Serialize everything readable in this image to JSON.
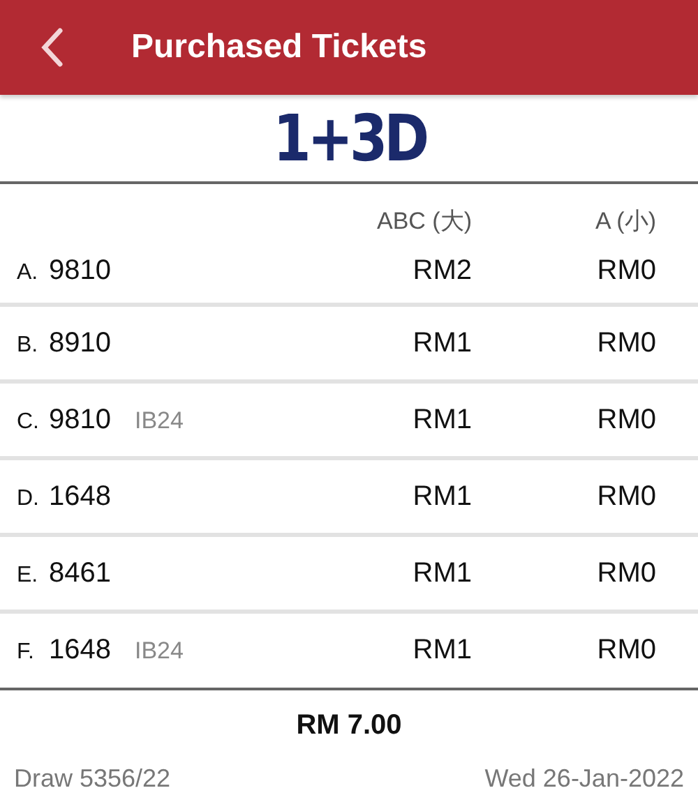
{
  "header": {
    "title": "Purchased Tickets"
  },
  "logo": "1+3D",
  "table": {
    "columns": [
      "ABC (大)",
      "A (小)"
    ],
    "rows": [
      {
        "letter": "A.",
        "number": "9810",
        "big": "RM2",
        "small": "RM0"
      },
      {
        "letter": "B.",
        "number": "8910",
        "big": "RM1",
        "small": "RM0"
      },
      {
        "letter": "C.",
        "number": "9810",
        "tag": "IB24",
        "big": "RM1",
        "small": "RM0"
      },
      {
        "letter": "D.",
        "number": "1648",
        "big": "RM1",
        "small": "RM0"
      },
      {
        "letter": "E.",
        "number": "8461",
        "big": "RM1",
        "small": "RM0"
      },
      {
        "letter": "F.",
        "number": "1648",
        "tag": "IB24",
        "big": "RM1",
        "small": "RM0"
      }
    ]
  },
  "total": "RM 7.00",
  "footer": {
    "draw": "Draw 5356/22",
    "date": "Wed 26-Jan-2022"
  }
}
